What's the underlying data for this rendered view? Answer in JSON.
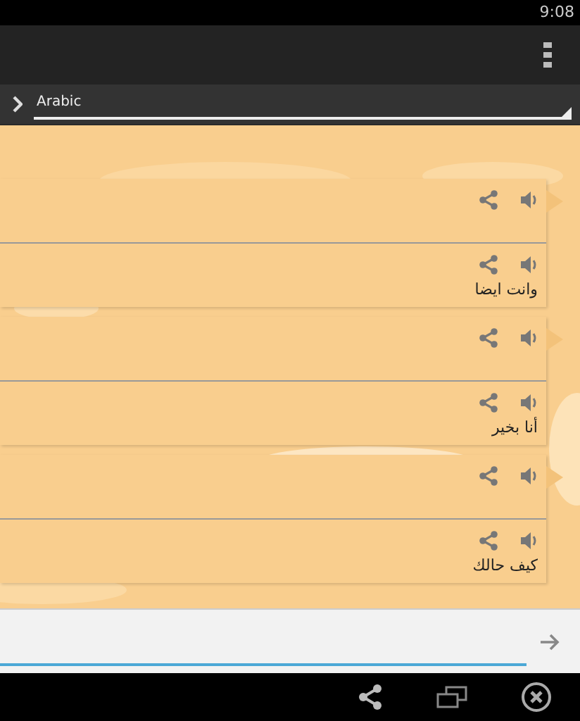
{
  "status_bar": {
    "time": "9:08"
  },
  "language_bar": {
    "language": "Arabic"
  },
  "cards": [
    {
      "text": "وانت ايضا"
    },
    {
      "text": "أنا بخير"
    },
    {
      "text": "كيف حالك"
    }
  ]
}
